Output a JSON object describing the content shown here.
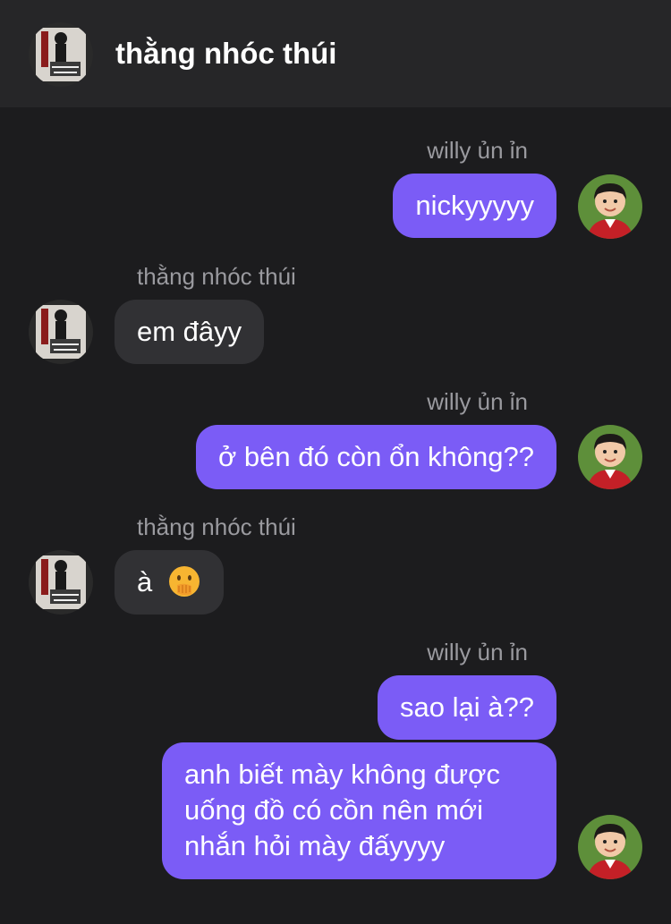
{
  "header": {
    "title": "thằng nhóc thúi",
    "avatar": "contact-avatar"
  },
  "colors": {
    "outgoing_bubble": "#7b5cf6",
    "incoming_bubble": "#313134",
    "background": "#1c1c1e",
    "header_bg": "#262628",
    "sender_name": "#9a9a9f"
  },
  "messages": [
    {
      "sender": "willy ủn ỉn",
      "direction": "out",
      "texts": [
        "nickyyyyy"
      ]
    },
    {
      "sender": "thằng nhóc thúi",
      "direction": "in",
      "texts": [
        "em đâyy"
      ]
    },
    {
      "sender": "willy ủn ỉn",
      "direction": "out",
      "texts": [
        "ở bên đó còn ổn không??"
      ]
    },
    {
      "sender": "thằng nhóc thúi",
      "direction": "in",
      "texts": [
        "à"
      ],
      "emoji": "face-with-hand-over-mouth"
    },
    {
      "sender": "willy ủn ỉn",
      "direction": "out",
      "texts": [
        "sao lại à??",
        "anh biết mày không được uống đồ có cồn nên mới nhắn hỏi mày đấyyyy"
      ]
    }
  ]
}
